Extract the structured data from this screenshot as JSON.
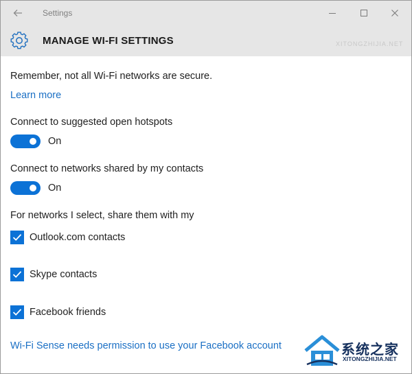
{
  "window": {
    "title": "Settings"
  },
  "header": {
    "title": "MANAGE WI-FI SETTINGS",
    "watermark": "XITONGZHIJIA.NET"
  },
  "content": {
    "intro": "Remember, not all Wi-Fi networks are secure.",
    "learn_more": "Learn more",
    "hotspots_label": "Connect to suggested open hotspots",
    "hotspots_state": "On",
    "contacts_label": "Connect to networks shared by my contacts",
    "contacts_state": "On",
    "share_heading": "For networks I select, share them with my",
    "share_options": [
      {
        "label": "Outlook.com contacts",
        "checked": true
      },
      {
        "label": "Skype contacts",
        "checked": true
      },
      {
        "label": "Facebook friends",
        "checked": true
      }
    ],
    "facebook_permission_link": "Wi-Fi Sense needs permission to use your Facebook account"
  },
  "watermark": {
    "name": "系统之家",
    "url": "XITONGZHIJIA.NET"
  },
  "colors": {
    "accent": "#0c72d6",
    "link": "#1a6fc4",
    "header_bg": "#e6e6e6"
  },
  "icons": [
    "back-arrow-icon",
    "minimize-icon",
    "maximize-icon",
    "close-icon",
    "gear-icon",
    "checkmark-icon"
  ]
}
